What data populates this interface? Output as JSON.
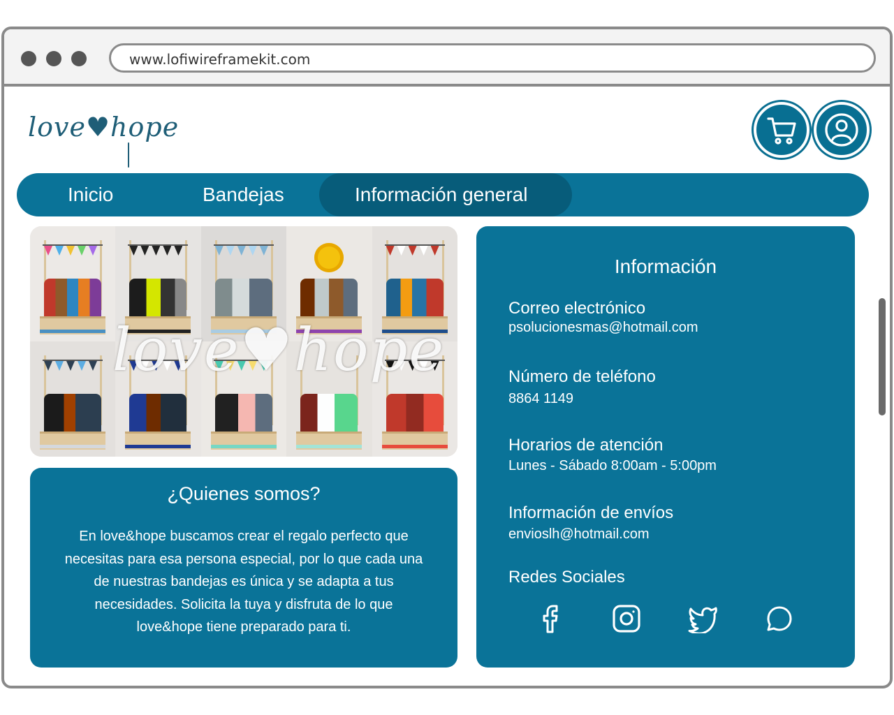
{
  "browser": {
    "url": "www.lofiwireframekit.com"
  },
  "header": {
    "logo_text": "love♥hope",
    "cart_icon": "cart-icon",
    "user_icon": "user-icon"
  },
  "nav": {
    "items": [
      {
        "label": "Inicio",
        "active": false
      },
      {
        "label": "Bandejas",
        "active": false
      },
      {
        "label": "Información general",
        "active": true
      }
    ]
  },
  "hero": {
    "logo_overlay": "love♥hope"
  },
  "about": {
    "title": "¿Quienes somos?",
    "lines": [
      "En love&hope buscamos crear el regalo perfecto que",
      "necesitas para esa persona especial, por lo que cada una",
      "de nuestras bandejas es única y se adapta a tus",
      "necesidades. Solicita la tuya y disfruta de lo que",
      "love&hope tiene preparado para ti."
    ]
  },
  "info": {
    "title": "Información",
    "email_label": "Correo electrónico",
    "email_value": "psolucionesmas@hotmail.com",
    "phone_label": "Número de teléfono",
    "phone_value": "8864 1149",
    "hours_label": "Horarios de atención",
    "hours_value": "Lunes - Sábado 8:00am - 5:00pm",
    "shipping_label": "Información de envíos",
    "shipping_value": "envioslh@hotmail.com",
    "social_label": "Redes Sociales",
    "social_icons": [
      "facebook-icon",
      "instagram-icon",
      "twitter-icon",
      "whatsapp-icon"
    ]
  },
  "colors": {
    "primary": "#0a7398",
    "primary_dark": "#075c7a",
    "logo": "#1f5e77",
    "frame": "#8a8a8a"
  }
}
